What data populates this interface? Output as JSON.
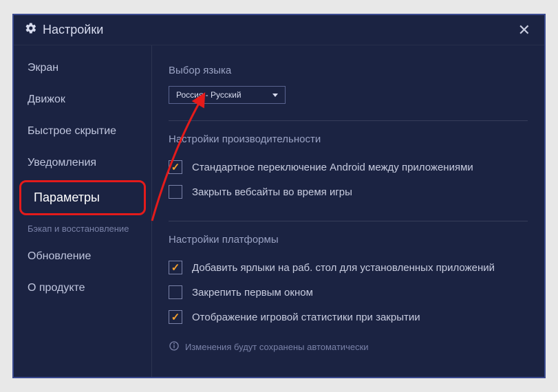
{
  "titlebar": {
    "title": "Настройки"
  },
  "sidebar": {
    "items": [
      {
        "label": "Экран"
      },
      {
        "label": "Движок"
      },
      {
        "label": "Быстрое скрытие"
      },
      {
        "label": "Уведомления"
      },
      {
        "label": "Параметры"
      },
      {
        "label": "Бэкап и восстановление"
      },
      {
        "label": "Обновление"
      },
      {
        "label": "О продукте"
      }
    ]
  },
  "content": {
    "language": {
      "title": "Выбор языка",
      "selected": "Россия - Русский"
    },
    "performance": {
      "title": "Настройки производительности",
      "opt1": "Стандартное переключение Android между приложениями",
      "opt2": "Закрыть вебсайты во время игры"
    },
    "platform": {
      "title": "Настройки платформы",
      "opt1": "Добавить ярлыки на раб. стол для установленных приложений",
      "opt2": "Закрепить первым окном",
      "opt3": "Отображение игровой статистики при закрытии"
    },
    "info": "Изменения будут сохранены автоматически"
  }
}
